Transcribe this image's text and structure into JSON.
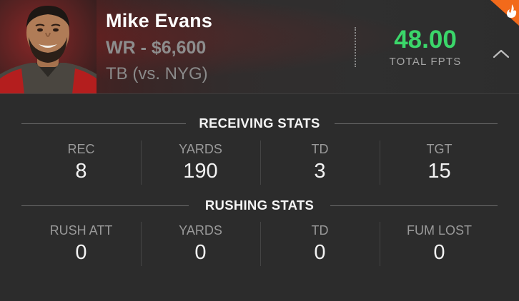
{
  "player": {
    "name": "Mike Evans",
    "position_salary": "WR - $6,600",
    "matchup": "TB (vs. NYG)",
    "total_fpts_value": "48.00",
    "total_fpts_label": "TOTAL FPTS"
  },
  "receiving": {
    "title": "RECEIVING STATS",
    "stats": [
      {
        "label": "REC",
        "value": "8"
      },
      {
        "label": "YARDS",
        "value": "190"
      },
      {
        "label": "TD",
        "value": "3"
      },
      {
        "label": "TGT",
        "value": "15"
      }
    ]
  },
  "rushing": {
    "title": "RUSHING STATS",
    "stats": [
      {
        "label": "RUSH ATT",
        "value": "0"
      },
      {
        "label": "YARDS",
        "value": "0"
      },
      {
        "label": "TD",
        "value": "0"
      },
      {
        "label": "FUM LOST",
        "value": "0"
      }
    ]
  },
  "icons": {
    "collapse": "chevron-up-icon",
    "hot": "flame-icon",
    "avatar": "player-headshot"
  },
  "colors": {
    "fpts": "#3bd66a",
    "hot_badge": "#f26a1b",
    "header_accent": "#5a1c1c"
  }
}
